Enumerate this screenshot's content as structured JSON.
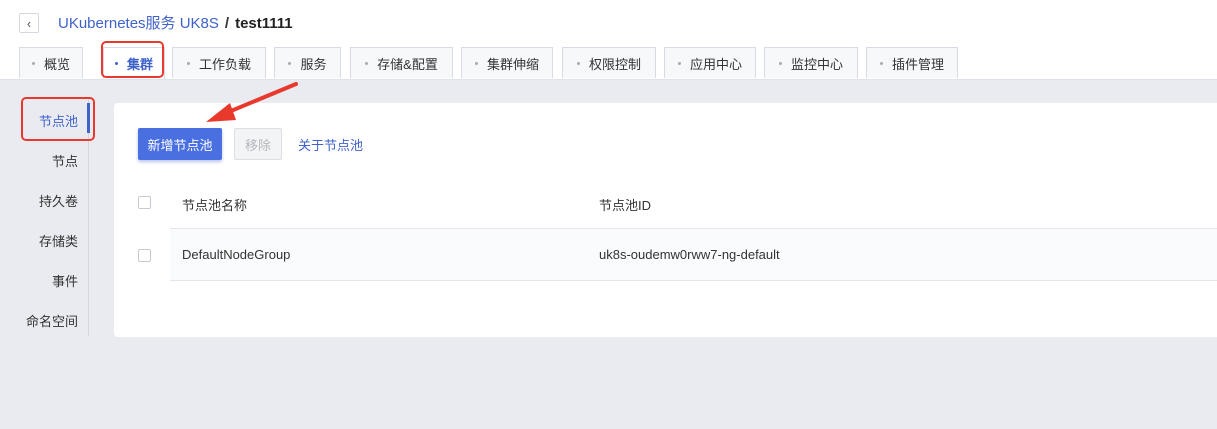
{
  "header": {
    "back_icon": "chevron-left-icon",
    "back_glyph": "‹",
    "breadcrumb_service": "UKubernetes服务 UK8S",
    "separator": "/",
    "cluster_name": "test1111"
  },
  "tabs": [
    {
      "label": "概览"
    },
    {
      "label": "集群",
      "active": true
    },
    {
      "label": "工作负载"
    },
    {
      "label": "服务"
    },
    {
      "label": "存储&配置"
    },
    {
      "label": "集群伸缩"
    },
    {
      "label": "权限控制"
    },
    {
      "label": "应用中心"
    },
    {
      "label": "监控中心"
    },
    {
      "label": "插件管理"
    }
  ],
  "sidebar": {
    "items": [
      {
        "label": "节点池",
        "active": true
      },
      {
        "label": "节点"
      },
      {
        "label": "持久卷"
      },
      {
        "label": "存储类"
      },
      {
        "label": "事件"
      },
      {
        "label": "命名空间"
      }
    ]
  },
  "toolbar": {
    "add_label": "新增节点池",
    "remove_label": "移除",
    "about_label": "关于节点池"
  },
  "table": {
    "columns": [
      "节点池名称",
      "节点池ID"
    ],
    "rows": [
      {
        "name": "DefaultNodeGroup",
        "id": "uk8s-oudemw0rww7-ng-default"
      }
    ]
  },
  "annotation": {
    "highlight_color": "#e8392c"
  },
  "colors": {
    "accent": "#3f63c9",
    "primary_button": "#4a6fe0"
  }
}
